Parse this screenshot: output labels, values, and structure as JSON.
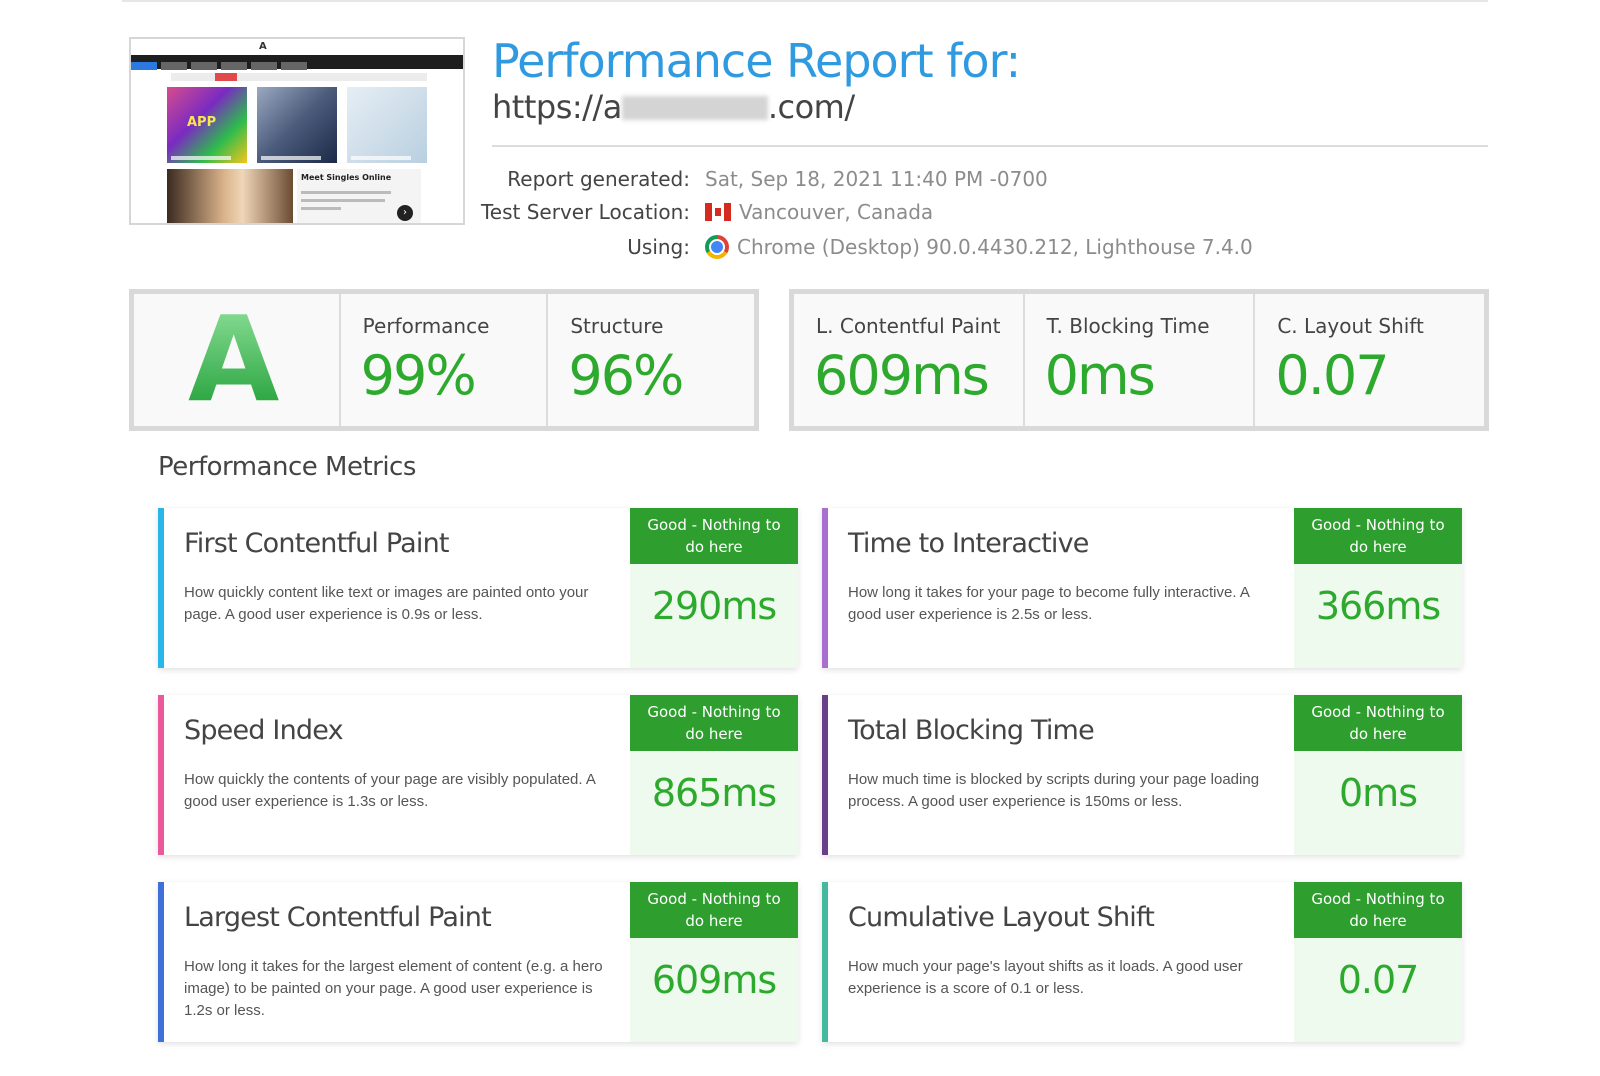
{
  "header": {
    "title": "Performance Report for:",
    "url_prefix": "https://a",
    "url_suffix": ".com/"
  },
  "thumbnail": {
    "logo_text": "A",
    "tile_text": "APP",
    "ad_title": "Meet Singles Online"
  },
  "info": {
    "generated_label": "Report generated:",
    "generated_value": "Sat, Sep 18, 2021 11:40 PM -0700",
    "location_label": "Test Server Location:",
    "location_value": "Vancouver, Canada",
    "location_flag": "canada-flag-icon",
    "using_label": "Using:",
    "using_value": "Chrome (Desktop) 90.0.4430.212, Lighthouse 7.4.0",
    "using_icon": "chrome-icon"
  },
  "scores": {
    "grade": "A",
    "performance_label": "Performance",
    "performance_value": "99%",
    "structure_label": "Structure",
    "structure_value": "96%",
    "lcp_label": "L. Contentful Paint",
    "lcp_value": "609ms",
    "tbt_label": "T. Blocking Time",
    "tbt_value": "0ms",
    "cls_label": "C. Layout Shift",
    "cls_value": "0.07"
  },
  "metrics_title": "Performance Metrics",
  "metrics": [
    {
      "title": "First Contentful Paint",
      "desc": "How quickly content like text or images are painted onto your page. A good user experience is 0.9s or less.",
      "status": "Good - Nothing to do here",
      "value": "290ms",
      "color": "#29b6e8"
    },
    {
      "title": "Time to Interactive",
      "desc": "How long it takes for your page to become fully interactive. A good user experience is 2.5s or less.",
      "status": "Good - Nothing to do here",
      "value": "366ms",
      "color": "#a86fd0"
    },
    {
      "title": "Speed Index",
      "desc": "How quickly the contents of your page are visibly populated. A good user experience is 1.3s or less.",
      "status": "Good - Nothing to do here",
      "value": "865ms",
      "color": "#ea5a9a"
    },
    {
      "title": "Total Blocking Time",
      "desc": "How much time is blocked by scripts during your page loading process. A good user experience is 150ms or less.",
      "status": "Good - Nothing to do here",
      "value": "0ms",
      "color": "#6a3f8a"
    },
    {
      "title": "Largest Contentful Paint",
      "desc": "How long it takes for the largest element of content (e.g. a hero image) to be painted on your page. A good user experience is 1.2s or less.",
      "status": "Good - Nothing to do here",
      "value": "609ms",
      "color": "#3f6fd8"
    },
    {
      "title": "Cumulative Layout Shift",
      "desc": "How much your page's layout shifts as it loads. A good user experience is a score of 0.1 or less.",
      "status": "Good - Nothing to do here",
      "value": "0.07",
      "color": "#45b8a0"
    }
  ]
}
